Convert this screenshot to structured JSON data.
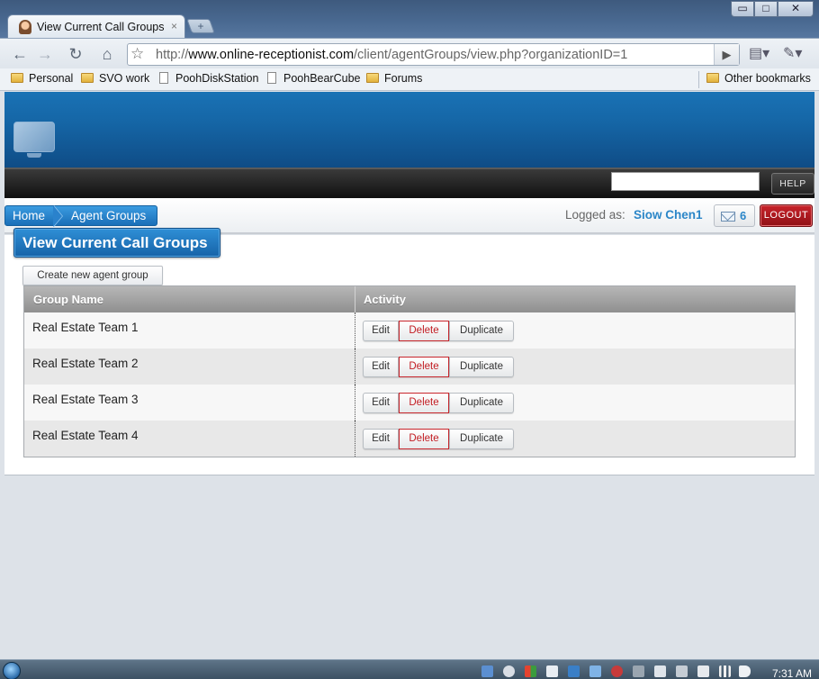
{
  "browser": {
    "tab_title": "View Current Call Groups",
    "tab_close": "×",
    "new_tab": "+",
    "window_controls": {
      "minimize": "▭",
      "maximize": "□",
      "close": "✕"
    },
    "url_prefix": "http://",
    "url_domain": "www.online-receptionist.com",
    "url_path": "/client/agentGroups/view.php?organizationID=1",
    "bookmarks": [
      "Personal",
      "SVO work",
      "PoohDiskStation",
      "PoohBearCube",
      "Forums"
    ],
    "other_bookmarks": "Other bookmarks"
  },
  "header": {
    "help_label": "HELP",
    "search_value": ""
  },
  "breadcrumb": {
    "home": "Home",
    "current": "Agent Groups"
  },
  "user": {
    "logged_label": "Logged as:",
    "name": "Siow Chen1",
    "message_count": "6",
    "logout_label": "LOGOUT"
  },
  "main": {
    "title": "View Current Call Groups",
    "create_button": "Create new agent group",
    "columns": [
      "Group Name",
      "Activity"
    ],
    "rows": [
      {
        "name": "Real Estate Team 1"
      },
      {
        "name": "Real Estate Team 2"
      },
      {
        "name": "Real Estate Team 3"
      },
      {
        "name": "Real Estate Team 4"
      }
    ],
    "actions": {
      "edit": "Edit",
      "delete": "Delete",
      "duplicate": "Duplicate"
    }
  },
  "taskbar": {
    "clock": "7:31 AM"
  },
  "colors": {
    "brand_blue": "#1a6fb8",
    "logout_red": "#b0181e",
    "delete_red": "#c21c22"
  }
}
